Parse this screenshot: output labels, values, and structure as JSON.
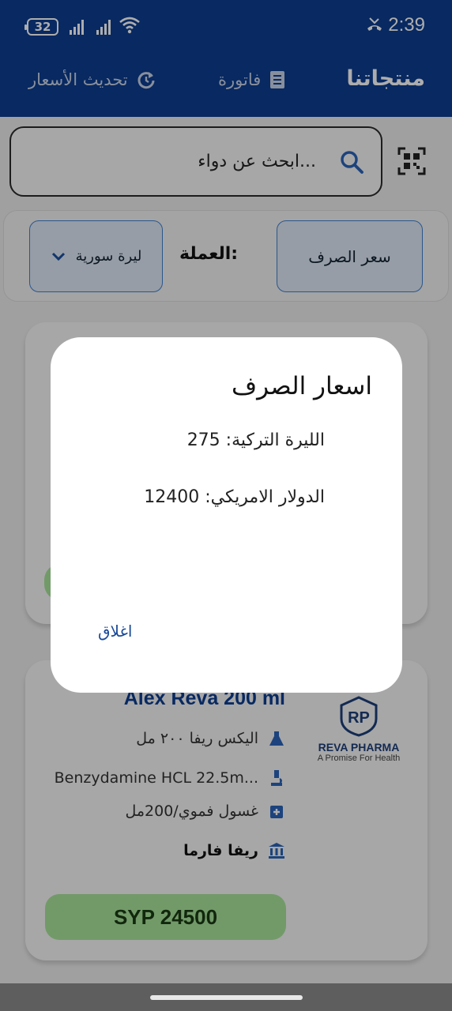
{
  "status_bar": {
    "battery": "32",
    "time": "2:39"
  },
  "app_bar": {
    "title": "منتجاتنا",
    "invoice_label": "فاتورة",
    "refresh_label": "تحديث الأسعار"
  },
  "search": {
    "placeholder": "ابحث عن دواء..."
  },
  "currency": {
    "rate_button": "سعر الصرف",
    "label": "العملة:",
    "selected": "ليرة سورية"
  },
  "product": {
    "title": "Alex Reva 200 ml",
    "arabic_name": "اليكس ريفا ٢٠٠ مل",
    "ingredient": "Benzydamine HCL 22.5m...",
    "form": "غسول فموي/200مل",
    "company": "ريفا فارما",
    "price": "SYP 24500",
    "brand_name": "REVA PHARMA",
    "brand_tagline": "A Promise For Health"
  },
  "dialog": {
    "title": "اسعار الصرف",
    "try_rate": "الليرة التركية: 275",
    "usd_rate": "الدولار الامريكي: 12400",
    "close": "اغلاق"
  },
  "colors": {
    "primary": "#0d3d8f",
    "price_bg": "#a8e39b",
    "link": "#1a4a99"
  }
}
